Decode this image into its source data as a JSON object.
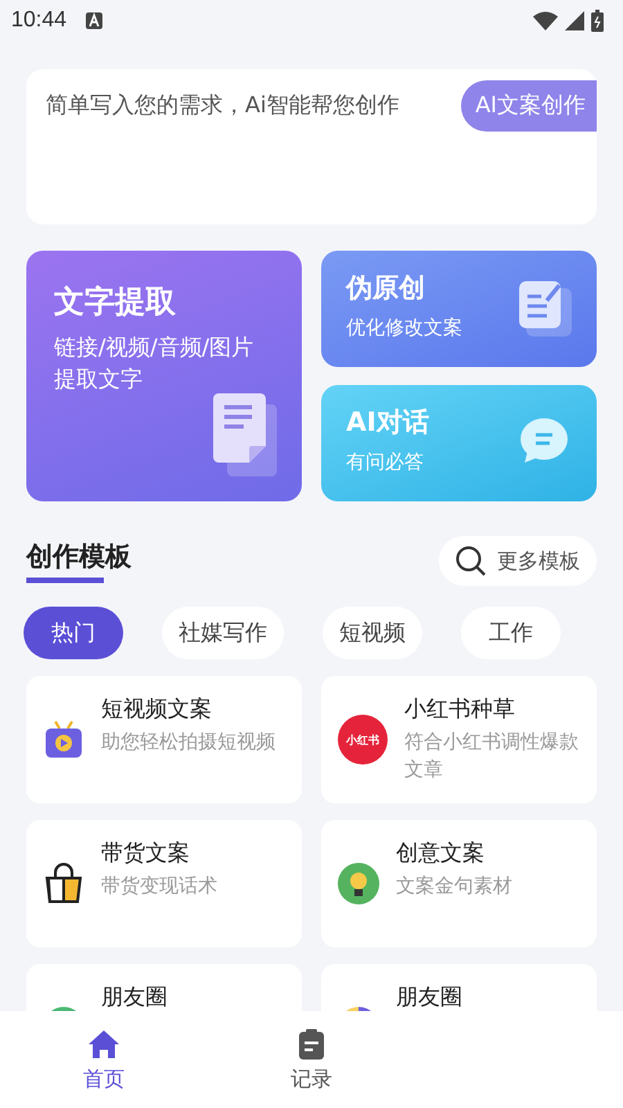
{
  "status_bar": {
    "time": "10:44"
  },
  "prompt": {
    "placeholder": "简单写入您的需求，Ai智能帮您创作",
    "button": "AI文案创作"
  },
  "features": [
    {
      "kind": "extract",
      "title": "文字提取",
      "subtitle": "链接/视频/音频/图片提取文字"
    },
    {
      "kind": "rewrite",
      "title": "伪原创",
      "subtitle": "优化修改文案"
    },
    {
      "kind": "chat",
      "title": "AI对话",
      "subtitle": "有问必答"
    }
  ],
  "section": {
    "title": "创作模板",
    "more": "更多模板"
  },
  "tabs": [
    {
      "label": "热门",
      "selected": true
    },
    {
      "label": "社媒写作",
      "selected": false
    },
    {
      "label": "短视频",
      "selected": false
    },
    {
      "label": "工作",
      "selected": false
    }
  ],
  "templates": [
    {
      "kind": "video",
      "title": "短视频文案",
      "desc": "助您轻松拍摄短视频"
    },
    {
      "kind": "redbook",
      "logo_text": "小红书",
      "title": "小红书种草",
      "desc": "符合小红书调性爆款文章"
    },
    {
      "kind": "bag",
      "title": "带货文案",
      "desc": "带货变现话术"
    },
    {
      "kind": "bulb",
      "title": "创意文案",
      "desc": "文案金句素材"
    },
    {
      "kind": "moments",
      "title": "朋友圈"
    },
    {
      "kind": "pie",
      "title": "朋友圈"
    }
  ],
  "bottom_nav": [
    {
      "kind": "home",
      "label": "首页",
      "selected": true
    },
    {
      "kind": "record",
      "label": "记录",
      "selected": false
    }
  ]
}
